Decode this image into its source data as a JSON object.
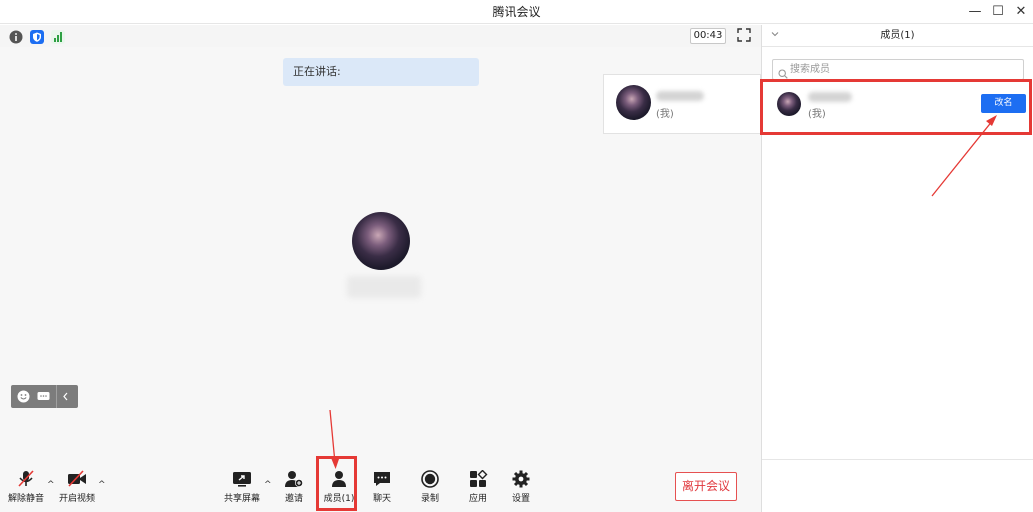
{
  "window": {
    "title": "腾讯会议",
    "controls": {
      "minimize": "—",
      "maximize": "☐",
      "close": "✕"
    }
  },
  "status_bar": {
    "timer": "00:43",
    "icons": [
      "info-icon",
      "shield-icon",
      "signal-icon"
    ],
    "icon_colors": {
      "info": "#555555",
      "shield": "#1d6ef2",
      "signal": "#2ea043"
    }
  },
  "meeting": {
    "speaking_label": "正在讲话:",
    "float_member": {
      "me_tag": "(我)"
    }
  },
  "mini_toolbar": {
    "icons": [
      "emoji-icon",
      "chat-bubble-icon",
      "chevron-left-icon"
    ]
  },
  "toolbar": {
    "unmute": "解除静音",
    "start_video": "开启视频",
    "share_screen": "共享屏幕",
    "invite": "邀请",
    "members": "成员(1)",
    "chat": "聊天",
    "record": "录制",
    "apps": "应用",
    "settings": "设置",
    "leave": "离开会议"
  },
  "panel": {
    "title": "成员(1)",
    "search_placeholder": "搜索成员",
    "member": {
      "me_tag": "(我)",
      "rename_label": "改名"
    }
  },
  "colors": {
    "accent": "#1d6ef2",
    "leave_red": "#e0393e",
    "annotation_red": "#e53935"
  }
}
